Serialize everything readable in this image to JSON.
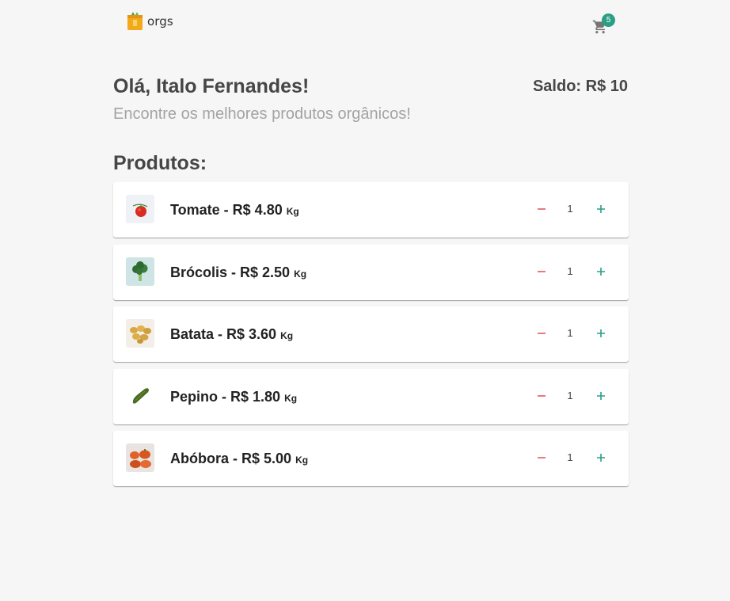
{
  "header": {
    "logo_text": "orgs",
    "cart_count": "5"
  },
  "greeting": "Olá, Italo Fernandes!",
  "balance": "Saldo: R$ 10",
  "subtitle": "Encontre os melhores produtos orgânicos!",
  "section_title": "Produtos:",
  "products": [
    {
      "name": "Tomate - R$ 4.80",
      "unit": "Kg",
      "quantity": "1",
      "icon": "tomato-icon"
    },
    {
      "name": "Brócolis - R$ 2.50",
      "unit": "Kg",
      "quantity": "1",
      "icon": "broccoli-icon"
    },
    {
      "name": "Batata - R$ 3.60",
      "unit": "Kg",
      "quantity": "1",
      "icon": "potato-icon"
    },
    {
      "name": "Pepino - R$ 1.80",
      "unit": "Kg",
      "quantity": "1",
      "icon": "cucumber-icon"
    },
    {
      "name": "Abóbora - R$ 5.00",
      "unit": "Kg",
      "quantity": "1",
      "icon": "pumpkin-icon"
    }
  ],
  "colors": {
    "accent": "#2a9f85",
    "minus": "#e05a5a",
    "text": "#464646",
    "muted": "#a3a3a3",
    "background": "#f6f6f6"
  }
}
